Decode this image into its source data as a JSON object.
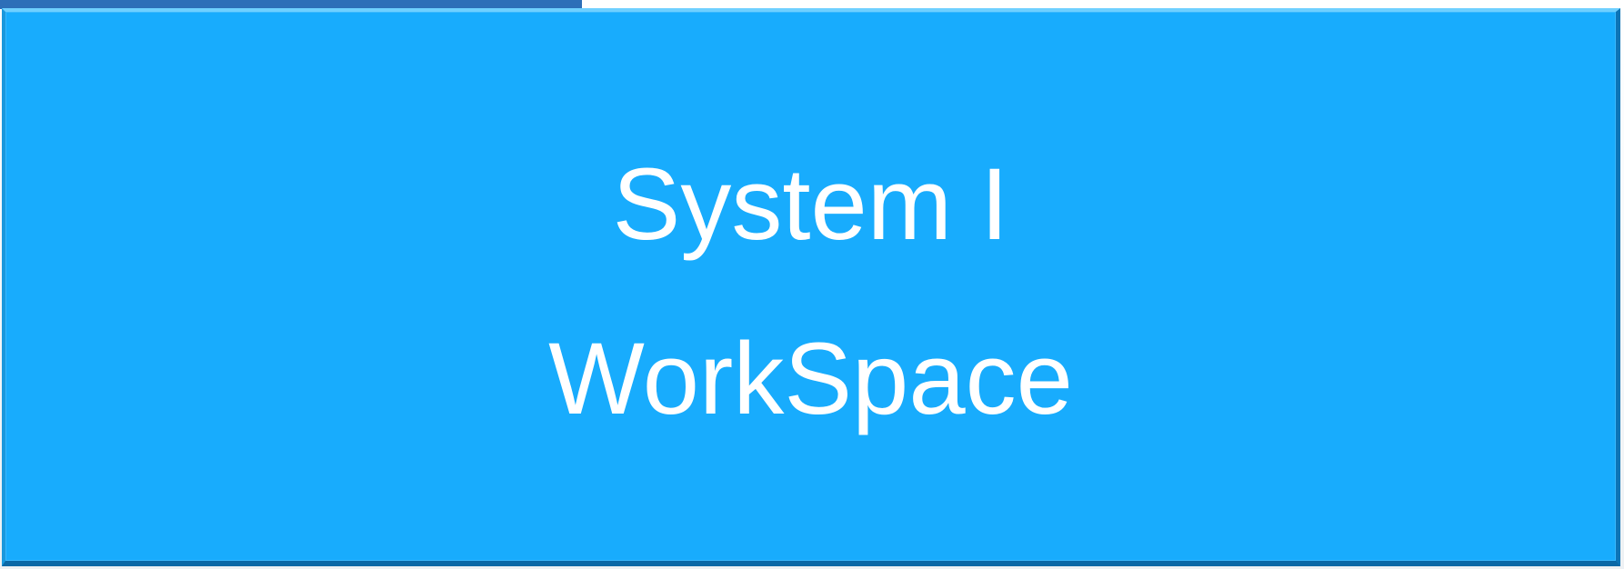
{
  "panel": {
    "title_line1": "System I",
    "title_line2": "WorkSpace",
    "background_color": "#18acfd",
    "text_color": "#ffffff"
  }
}
